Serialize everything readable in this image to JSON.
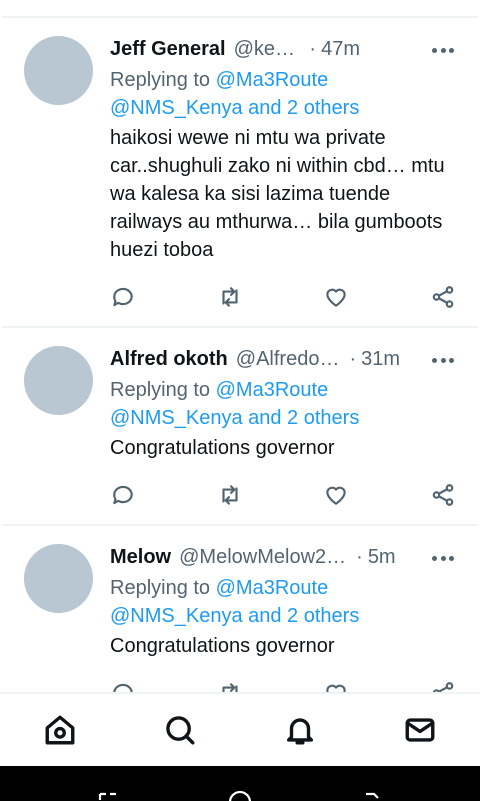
{
  "tweets": [
    {
      "name": "Jeff General",
      "handle": "@kenger…",
      "separator": "·",
      "time": "47m",
      "replying_prefix": "Replying to",
      "replying_to_1": "@Ma3Route",
      "replying_to_2": "@NMS_Kenya and 2 others",
      "text": "haikosi wewe ni mtu wa private car..shughuli zako ni within cbd… mtu wa kalesa ka sisi lazima tuende railways au mthurwa… bila gumboots huezi toboa"
    },
    {
      "name": "Alfred okoth",
      "handle": "@Alfredo…",
      "separator": "·",
      "time": "31m",
      "replying_prefix": "Replying to",
      "replying_to_1": "@Ma3Route",
      "replying_to_2": "@NMS_Kenya and 2 others",
      "text": "Congratulations governor"
    },
    {
      "name": "Melow",
      "handle": "@MelowMelow2…",
      "separator": "·",
      "time": "5m",
      "replying_prefix": "Replying to",
      "replying_to_1": "@Ma3Route",
      "replying_to_2": "@NMS_Kenya and 2 others",
      "text": "Congratulations governor"
    }
  ],
  "icons": {
    "more": "more-icon",
    "reply": "reply-icon",
    "retweet": "retweet-icon",
    "like": "like-icon",
    "share": "share-icon",
    "nav_home": "home-icon",
    "nav_search": "search-icon",
    "nav_notifications": "bell-icon",
    "nav_messages": "mail-icon"
  },
  "colors": {
    "mention": "#1d9bf0",
    "secondary_text": "#536471",
    "avatar_placeholder": "#b8c7d1"
  }
}
